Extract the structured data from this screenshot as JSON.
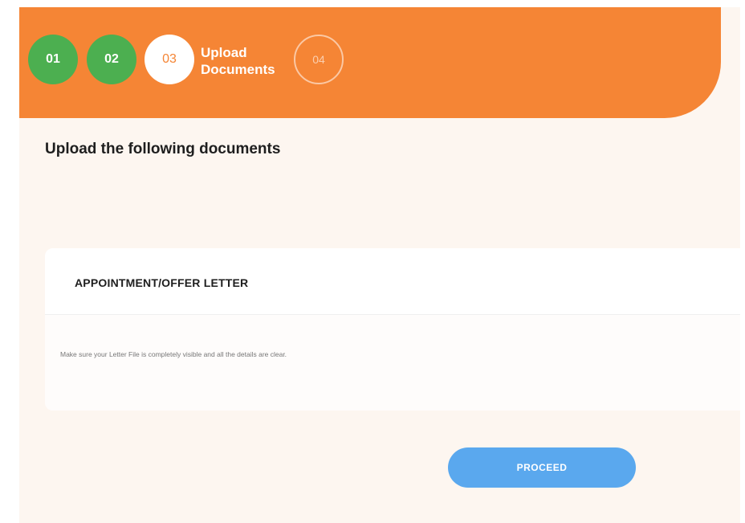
{
  "colors": {
    "header": "#f58535",
    "step_done": "#4caf50",
    "step_current_text": "#f58535",
    "page_background": "#fdf6f0",
    "proceed_button": "#5aa8ee"
  },
  "stepper": {
    "steps": [
      {
        "number": "01",
        "state": "done"
      },
      {
        "number": "02",
        "state": "done"
      },
      {
        "number": "03",
        "state": "current",
        "label_line1": "Upload",
        "label_line2": "Documents"
      },
      {
        "number": "04",
        "state": "pending"
      }
    ]
  },
  "main": {
    "title": "Upload the following documents",
    "document_card": {
      "title": "APPOINTMENT/OFFER LETTER",
      "note": "Make sure your Letter File is completely visible and all the details are clear."
    },
    "proceed_label": "PROCEED"
  }
}
